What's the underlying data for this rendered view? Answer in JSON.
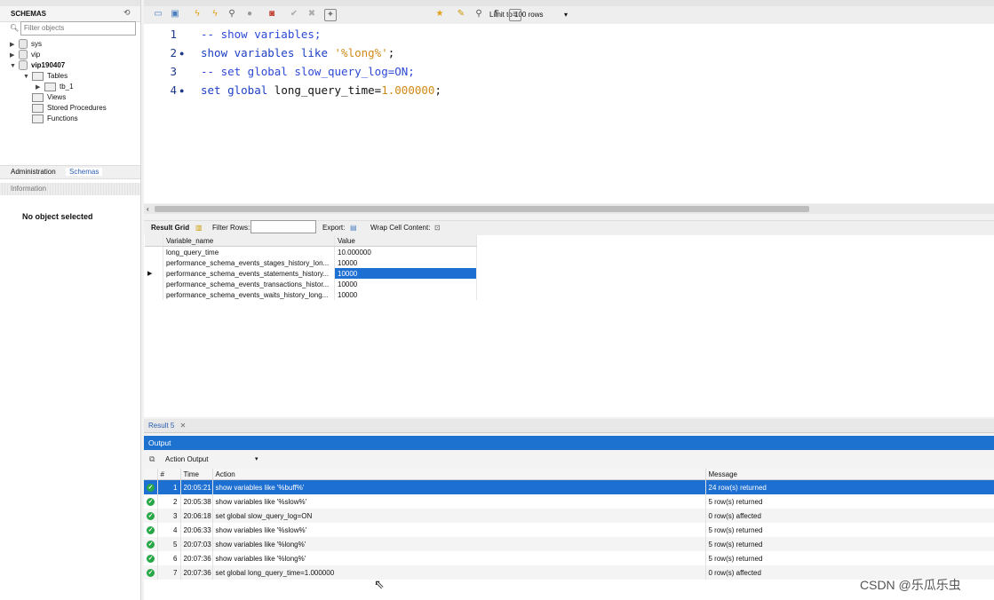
{
  "navigator": {
    "schemas_title": "SCHEMAS",
    "filter_placeholder": "Filter objects",
    "tree": {
      "sys": "sys",
      "vip": "vip",
      "vip190407": "vip190407",
      "tables": "Tables",
      "tb_1": "tb_1",
      "views": "Views",
      "stored_procedures": "Stored Procedures",
      "functions": "Functions"
    },
    "tabs": {
      "administration": "Administration",
      "schemas": "Schemas"
    },
    "information_title": "Information",
    "no_object": "No object selected"
  },
  "toolbar": {
    "limit": "Limit to 100 rows"
  },
  "editor": {
    "lines": [
      {
        "num": "1",
        "text": "-- show variables;"
      },
      {
        "num": "2",
        "kw": "show variables like ",
        "str": "'%long%'",
        "rest": ";"
      },
      {
        "num": "3",
        "text": "-- set global slow_query_log=ON;"
      },
      {
        "num": "4",
        "kw": "set global ",
        "plain": "long_query_time=",
        "val": "1.000000",
        "rest": ";"
      }
    ]
  },
  "result_bar": {
    "result_grid": "Result Grid",
    "filter_rows": "Filter Rows:",
    "export": "Export:",
    "wrap": "Wrap Cell Content:"
  },
  "grid": {
    "headers": [
      "Variable_name",
      "Value"
    ],
    "rows": [
      [
        "long_query_time",
        "10.000000"
      ],
      [
        "performance_schema_events_stages_history_lon...",
        "10000"
      ],
      [
        "performance_schema_events_statements_history...",
        "10000"
      ],
      [
        "performance_schema_events_transactions_histor...",
        "10000"
      ],
      [
        "performance_schema_events_waits_history_long...",
        "10000"
      ]
    ]
  },
  "output": {
    "result_tab": "Result 5",
    "title": "Output",
    "action_output": "Action Output",
    "headers": [
      "#",
      "Time",
      "Action",
      "Message"
    ],
    "rows": [
      [
        "1",
        "20:05:21",
        "show variables like '%buff%'",
        "24 row(s) returned"
      ],
      [
        "2",
        "20:05:38",
        "show variables like '%slow%'",
        "5 row(s) returned"
      ],
      [
        "3",
        "20:06:18",
        "set global slow_query_log=ON",
        "0 row(s) affected"
      ],
      [
        "4",
        "20:06:33",
        "show variables like '%slow%'",
        "5 row(s) returned"
      ],
      [
        "5",
        "20:07:03",
        "show variables like '%long%'",
        "5 row(s) returned"
      ],
      [
        "6",
        "20:07:36",
        "show variables like '%long%'",
        "5 row(s) returned"
      ],
      [
        "7",
        "20:07:36",
        "set global long_query_time=1.000000",
        "0 row(s) affected"
      ]
    ]
  },
  "watermark": "CSDN @乐瓜乐虫"
}
